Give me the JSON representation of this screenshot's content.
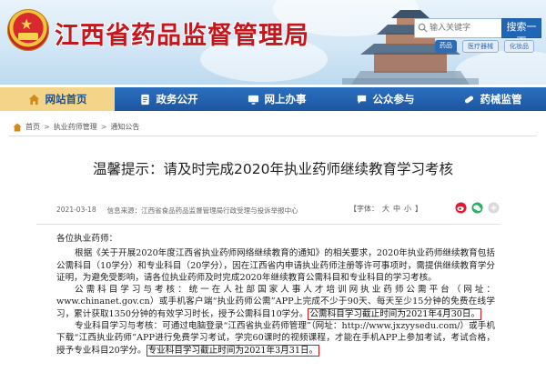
{
  "header": {
    "site_title": "江西省药品监督管理局",
    "search": {
      "placeholder": "输入关键字",
      "button_label": "搜索一下"
    },
    "tags": [
      "药品",
      "医疗器械",
      "化妆品"
    ]
  },
  "nav": {
    "items": [
      {
        "label": "网站首页",
        "icon": "home-icon",
        "active": true
      },
      {
        "label": "政务公开",
        "icon": "document-icon",
        "active": false
      },
      {
        "label": "网上办事",
        "icon": "monitor-icon",
        "active": false
      },
      {
        "label": "公众参与",
        "icon": "chat-icon",
        "active": false
      },
      {
        "label": "药械监管",
        "icon": "pill-icon",
        "active": false
      }
    ]
  },
  "breadcrumb": {
    "items": [
      "首页",
      "执业药师管理",
      "通知公告"
    ],
    "separator": ">"
  },
  "article": {
    "title": "温馨提示：请及时完成2020年执业药师继续教育学习考核",
    "date": "2021-03-18",
    "source": "信息来源：江西省食品药品监督管理局行政受理与投诉举报中心",
    "fontsize": {
      "prefix": "【字体：",
      "large": "大",
      "medium": "中",
      "small": "小",
      "suffix": "】"
    },
    "greeting": "各位执业药师：",
    "para1": "根据《关于开展2020年度江西省执业药师网络继续教育的通知》的相关要求，2020年执业药师继续教育包括公需科目（10学分）和专业科目（20学分），因在江西省内申请执业药师注册等许可事项时，需提供继续教育学分证明，为避免受影响，请各位执业药师及时完成2020年继续教育公需科目和专业科目的学习考核。",
    "para2_before": "公需科目学习与考核：统一在人社部国家人事人才培训网执业药师公需平台（网址：www.chinanet.gov.cn）或手机客户端“执业药师公需”APP上完成不少于90天、每天至少15分钟的免费在线学习，累计获取1350分钟的有效学习时长，授予公需科目10学分。",
    "para2_highlight": "公需科目学习截止时间为2021年4月30日。",
    "para3_before": "专业科目学习与考核：可通过电脑登录“江西省执业药师管理”（网址：http://www.jxzyysedu.com/）或手机下载“江西执业药师”APP进行免费学习考试，学完60课时的视频课程，才能在手机APP上参加考试，考试合格，授予专业科目20学分。",
    "para3_highlight": "专业科目学习截止时间为2021年3月31日。"
  },
  "colors": {
    "title_red": "#c4161c",
    "nav_blue": "#1d56a0",
    "nav_active": "#f3d488",
    "highlight_border": "#e1131b"
  }
}
